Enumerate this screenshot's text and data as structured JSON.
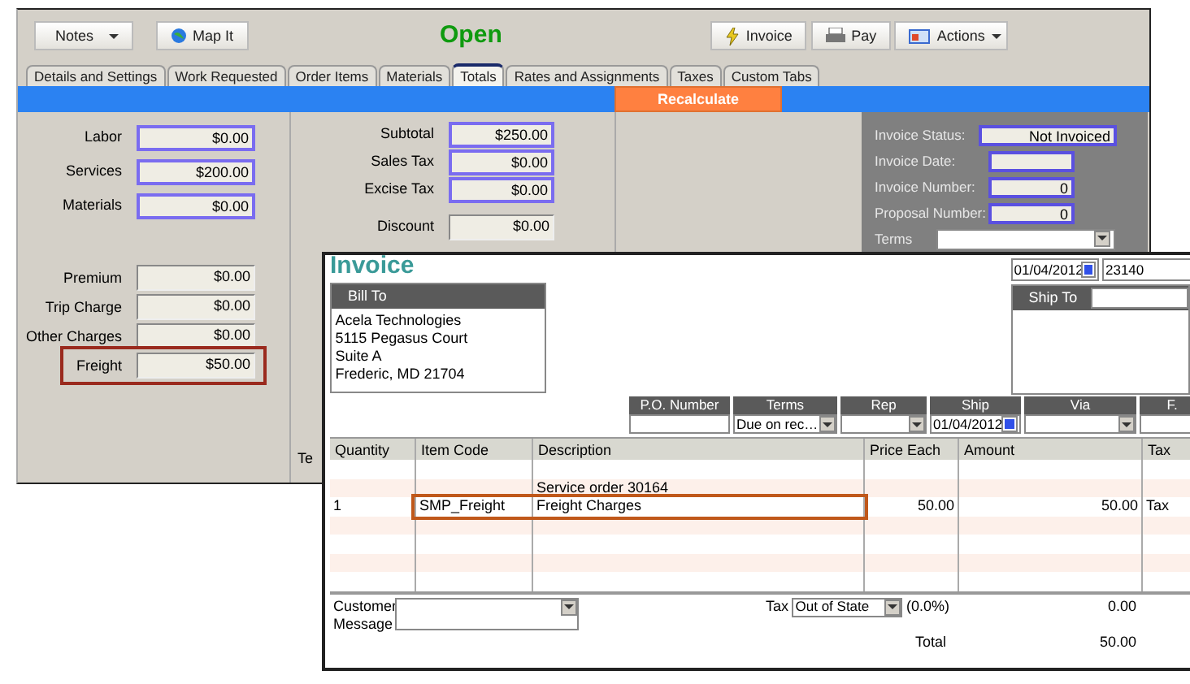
{
  "work_order": {
    "toolbar": {
      "notes_button": "Notes",
      "map_button": "Map It",
      "status": "Open",
      "invoice_button": "Invoice",
      "pay_button": "Pay",
      "actions_button": "Actions"
    },
    "tabs": [
      {
        "label": "Details and Settings",
        "selected": false
      },
      {
        "label": "Work Requested",
        "selected": false
      },
      {
        "label": "Order Items",
        "selected": false
      },
      {
        "label": "Materials",
        "selected": false
      },
      {
        "label": "Totals",
        "selected": true
      },
      {
        "label": "Rates and Assignments",
        "selected": false
      },
      {
        "label": "Taxes",
        "selected": false
      },
      {
        "label": "Custom Tabs",
        "selected": false
      }
    ],
    "recalculate_button": "Recalculate",
    "cost_fields": [
      {
        "label": "Labor",
        "value": "$0.00",
        "kind": "computed",
        "highlighted": false
      },
      {
        "label": "Services",
        "value": "$200.00",
        "kind": "computed",
        "highlighted": false
      },
      {
        "label": "Materials",
        "value": "$0.00",
        "kind": "computed",
        "highlighted": false
      }
    ],
    "charge_fields": [
      {
        "label": "Premium",
        "value": "$0.00",
        "kind": "input",
        "highlighted": false
      },
      {
        "label": "Trip Charge",
        "value": "$0.00",
        "kind": "input",
        "highlighted": false
      },
      {
        "label": "Other Charges",
        "value": "$0.00",
        "kind": "input",
        "highlighted": false
      },
      {
        "label": "Freight",
        "value": "$50.00",
        "kind": "input",
        "highlighted": true
      }
    ],
    "total_fields": [
      {
        "label": "Subtotal",
        "value": "$250.00",
        "kind": "computed"
      },
      {
        "label": "Sales Tax",
        "value": "$0.00",
        "kind": "computed"
      },
      {
        "label": "Excise Tax",
        "value": "$0.00",
        "kind": "computed"
      }
    ],
    "adjustment_fields": [
      {
        "label": "Discount",
        "value": "$0.00",
        "kind": "input"
      }
    ],
    "invoice_panel": [
      {
        "label": "Invoice Status:",
        "value": "Not Invoiced",
        "kind": "text"
      },
      {
        "label": "Invoice Date:",
        "kind": "text"
      },
      {
        "label": "Invoice Number:",
        "value": "0",
        "kind": "text"
      },
      {
        "label": "Proposal Number:",
        "value": "0",
        "kind": "text"
      },
      {
        "label": "Terms",
        "kind": "dropdown"
      }
    ],
    "cut_label": "Te"
  },
  "invoice": {
    "title": "Invoice",
    "date": "01/04/2012",
    "number": "23140",
    "bill_to": {
      "header": "Bill To",
      "lines": [
        "Acela Technologies",
        "5115 Pegasus Court",
        "Suite A",
        "Frederic, MD 21704"
      ]
    },
    "ship_to": {
      "header": "Ship To"
    },
    "header_fields": [
      {
        "label": "P.O. Number",
        "kind": "text"
      },
      {
        "label": "Terms",
        "value": "Due on rec…",
        "kind": "dropdown"
      },
      {
        "label": "Rep",
        "kind": "dropdown"
      },
      {
        "label": "Ship",
        "value": "01/04/2012",
        "kind": "date"
      },
      {
        "label": "Via",
        "kind": "dropdown"
      },
      {
        "label": "F.",
        "kind": "text"
      }
    ],
    "columns": [
      "Quantity",
      "Item Code",
      "Description",
      "Price Each",
      "Amount",
      "Tax"
    ],
    "rows": [
      {
        "highlighted": false
      },
      {
        "description": "Service order 30164",
        "highlighted": false
      },
      {
        "quantity": "1",
        "item_code": "SMP_Freight",
        "description": "Freight Charges",
        "price_each": "50.00",
        "amount": "50.00",
        "tax": "Tax",
        "highlighted": true
      },
      {
        "highlighted": false
      },
      {
        "highlighted": false
      },
      {
        "highlighted": false
      },
      {
        "highlighted": false
      }
    ],
    "customer_message_label": "Customer Message",
    "tax_label": "Tax",
    "tax_item": "Out of State",
    "tax_rate": "(0.0%)",
    "tax_amount": "0.00",
    "total_label": "Total",
    "total": "50.00"
  }
}
